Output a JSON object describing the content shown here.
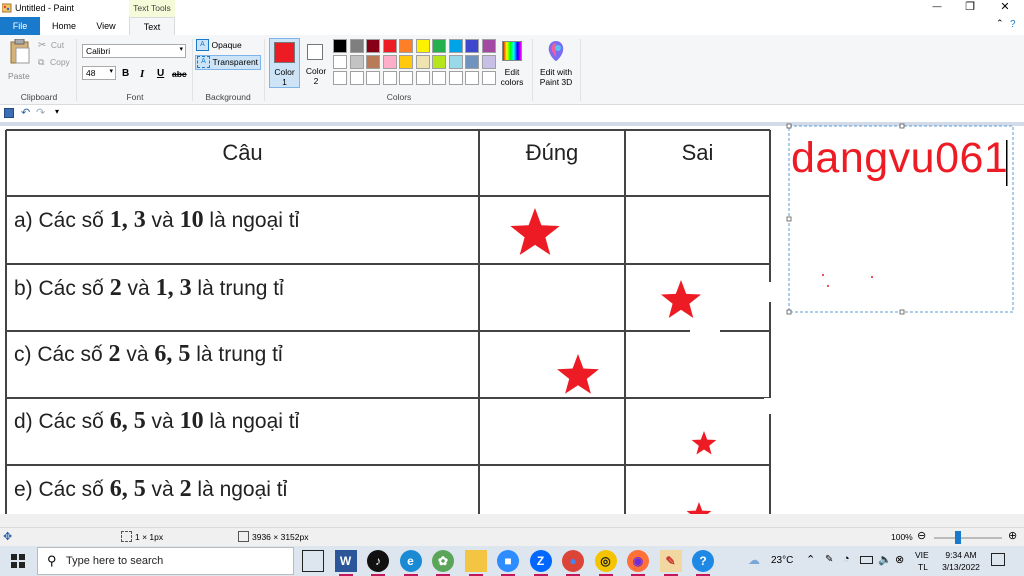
{
  "window": {
    "title": "Untitled - Paint",
    "context_tab": "Text Tools",
    "minimize": "—",
    "maximize": "❐",
    "close": "✕"
  },
  "tabs": [
    "File",
    "Home",
    "View",
    "Text"
  ],
  "ribbon": {
    "clipboard": {
      "paste": "Paste",
      "cut": "Cut",
      "copy": "Copy",
      "label": "Clipboard"
    },
    "font": {
      "family": "Calibri",
      "size": "48",
      "bold": "B",
      "italic": "I",
      "underline": "U",
      "strike": "abc",
      "label": "Font"
    },
    "background": {
      "opaque": "Opaque",
      "transparent": "Transparent",
      "label": "Background"
    },
    "colors": {
      "color1_label": "Color\n1",
      "color1_line1": "Color",
      "color1_line2": "1",
      "color2_line1": "Color",
      "color2_line2": "2",
      "edit_line1": "Edit",
      "edit_line2": "colors",
      "paint3d_line1": "Edit with",
      "paint3d_line2": "Paint 3D",
      "label": "Colors",
      "color1": "#ed1c24",
      "color2": "#ffffff",
      "palette_row1": [
        "#000000",
        "#7f7f7f",
        "#880015",
        "#ed1c24",
        "#ff7f27",
        "#fff200",
        "#22b14c",
        "#00a2e8",
        "#3f48cc",
        "#a349a4"
      ],
      "palette_row2": [
        "#ffffff",
        "#c3c3c3",
        "#b97a57",
        "#ffaec9",
        "#ffc90e",
        "#efe4b0",
        "#b5e61d",
        "#99d9ea",
        "#7092be",
        "#c8bfe7"
      ]
    }
  },
  "table": {
    "headers": [
      "Câu",
      "Đúng",
      "Sai"
    ],
    "rows": [
      {
        "pre": "a) Các số ",
        "n1": "1, 3",
        "mid": " và ",
        "n2": "10",
        "post": " là ngoại tỉ",
        "answer": "dung"
      },
      {
        "pre": "b) Các số ",
        "n1": "2",
        "mid": " và ",
        "n2": "1, 3",
        "post": " là trung tỉ",
        "answer": "sai"
      },
      {
        "pre": "c) Các số ",
        "n1": "2",
        "mid": " và ",
        "n2": "6, 5",
        "post": " là trung tỉ",
        "answer": "dung"
      },
      {
        "pre": "d) Các số ",
        "n1": "6, 5",
        "mid": " và ",
        "n2": "10",
        "post": " là ngoại tỉ",
        "answer": "sai"
      },
      {
        "pre": "e) Các số ",
        "n1": "6, 5",
        "mid": " và ",
        "n2": "2",
        "post": " là ngoại tỉ",
        "answer": "sai"
      }
    ],
    "mark_color": "#ed1c24"
  },
  "textbox": {
    "text": "dangvu061",
    "color": "#ed1c24"
  },
  "status": {
    "selection": "1 × 1px",
    "size": "3936 × 3152px",
    "zoom": "100%",
    "zoom_level": 0.35
  },
  "taskbar": {
    "search_placeholder": "Type here to search",
    "weather": "23°C",
    "lang1": "VIE",
    "lang2": "TL",
    "time": "9:34 AM",
    "date": "3/13/2022",
    "apps": [
      "task-view",
      "word",
      "tiktok",
      "edge",
      "photos",
      "explorer",
      "zoom-meetings",
      "zalo",
      "chrome",
      "app-circle",
      "firefox",
      "paint",
      "help"
    ]
  }
}
